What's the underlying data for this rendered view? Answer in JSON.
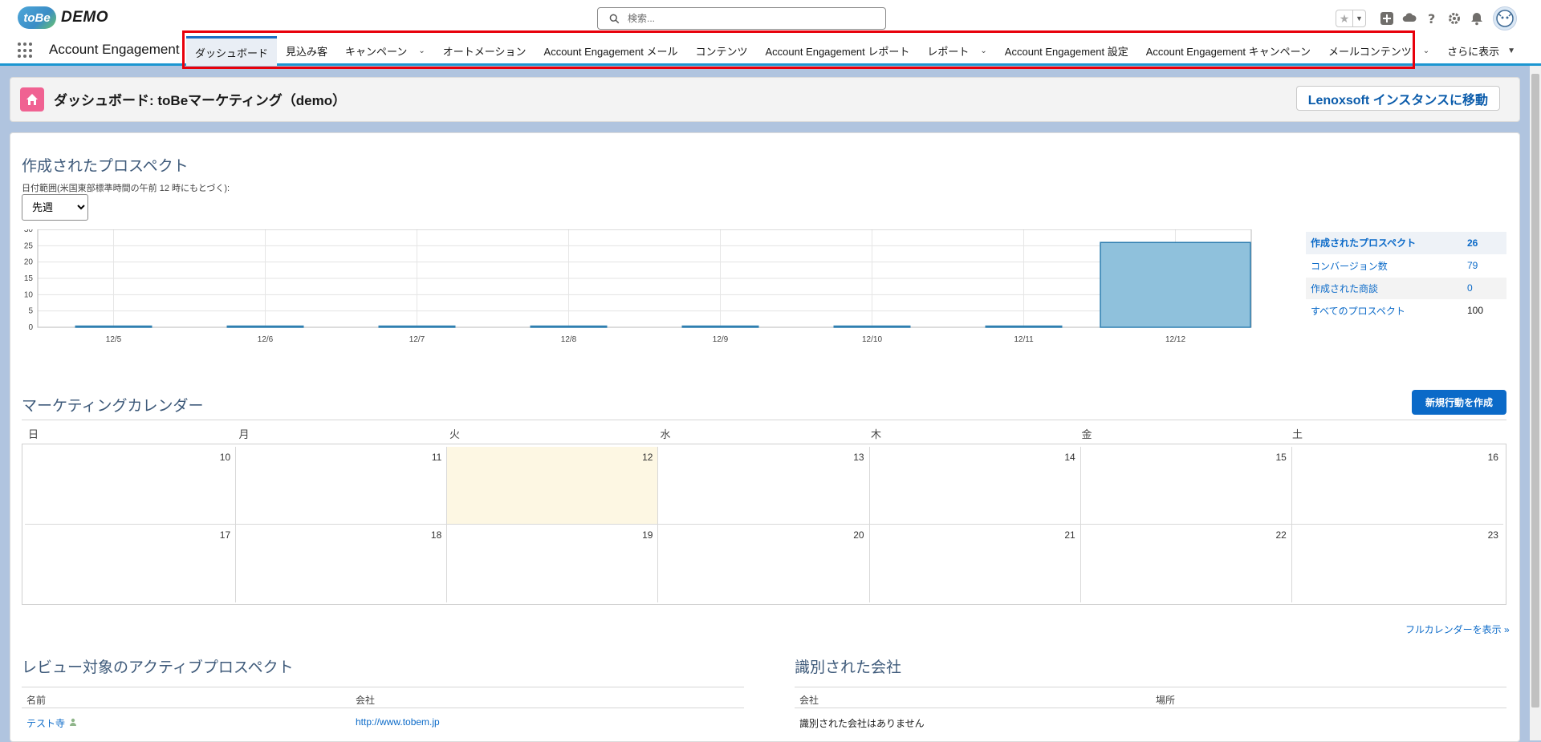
{
  "header": {
    "logo_mark": "toBe",
    "logo_text": "DEMO",
    "search_placeholder": "検索..."
  },
  "nav": {
    "app_name": "Account Engagement",
    "tabs": [
      {
        "label": "ダッシュボード",
        "active": true
      },
      {
        "label": "見込み客"
      },
      {
        "label": "キャンペーン",
        "dropdown": true
      },
      {
        "label": "オートメーション"
      },
      {
        "label": "Account Engagement メール"
      },
      {
        "label": "コンテンツ"
      },
      {
        "label": "Account Engagement レポート"
      },
      {
        "label": "レポート",
        "dropdown": true
      },
      {
        "label": "Account Engagement 設定"
      },
      {
        "label": "Account Engagement キャンペーン"
      },
      {
        "label": "メールコンテンツ",
        "dropdown": true
      },
      {
        "label": "さらに表示",
        "more": true
      }
    ]
  },
  "page_header": {
    "title": "ダッシュボード: toBeマーケティング（demo）",
    "move_button": "Lenoxsoft インスタンスに移動"
  },
  "prospects": {
    "title": "作成されたプロスペクト",
    "date_note": "日付範囲(米国東部標準時間の午前 12 時にもとづく):",
    "date_selected": "先週",
    "stats": [
      {
        "label": "作成されたプロスペクト",
        "value": "26"
      },
      {
        "label": "コンバージョン数",
        "value": "79"
      },
      {
        "label": "作成された商談",
        "value": "0"
      },
      {
        "label": "すべてのプロスペクト",
        "value": "100"
      }
    ]
  },
  "chart_data": {
    "type": "bar",
    "categories": [
      "12/5",
      "12/6",
      "12/7",
      "12/8",
      "12/9",
      "12/10",
      "12/11",
      "12/12"
    ],
    "values": [
      0,
      0,
      0,
      0,
      0,
      0,
      0,
      26
    ],
    "ylim": [
      0,
      30
    ],
    "yticks": [
      0,
      5,
      10,
      15,
      20,
      25,
      30
    ],
    "grid": true,
    "bar_color": "#8fc1dc",
    "bar_edge_color": "#2f7fb0"
  },
  "calendar": {
    "title": "マーケティングカレンダー",
    "new_activity_button": "新規行動を作成",
    "weekdays": [
      "日",
      "月",
      "火",
      "水",
      "木",
      "金",
      "土"
    ],
    "dates": [
      "10",
      "11",
      "12",
      "13",
      "14",
      "15",
      "16",
      "17",
      "18",
      "19",
      "20",
      "21",
      "22",
      "23"
    ],
    "full_calendar_link": "フルカレンダーを表示 »"
  },
  "active_prospects": {
    "title": "レビュー対象のアクティブプロスペクト",
    "columns": [
      "名前",
      "会社"
    ],
    "rows": [
      {
        "name": "テスト寺",
        "company": "http://www.tobem.jp"
      }
    ]
  },
  "identified_companies": {
    "title": "識別された会社",
    "columns": [
      "会社",
      "場所"
    ],
    "empty_message": "識別された会社はありません"
  }
}
